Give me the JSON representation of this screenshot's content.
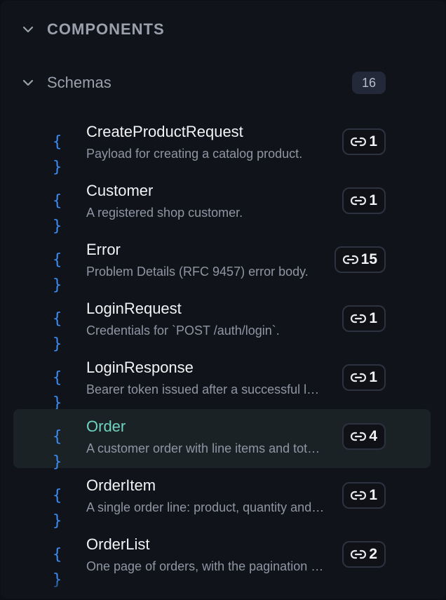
{
  "section": {
    "title": "COMPONENTS",
    "expanded": true,
    "icon": "chevron-down-icon"
  },
  "group": {
    "title": "Schemas",
    "count": "16",
    "expanded": true,
    "icon": "chevron-down-icon"
  },
  "item_icon": "schema-braces-icon",
  "ref_icon": "link-icon",
  "colors": {
    "accent_blue": "#3b8df5",
    "selected_text": "#6fd3c0",
    "selected_bg": "#1a2226"
  },
  "items": [
    {
      "name": "CreateProductRequest",
      "desc": "Payload for creating a catalog product.",
      "refs": "1",
      "selected": false
    },
    {
      "name": "Customer",
      "desc": "A registered shop customer.",
      "refs": "1",
      "selected": false
    },
    {
      "name": "Error",
      "desc": "Problem Details (RFC 9457) error body.",
      "refs": "15",
      "selected": false
    },
    {
      "name": "LoginRequest",
      "desc": "Credentials for `POST /auth/login`.",
      "refs": "1",
      "selected": false
    },
    {
      "name": "LoginResponse",
      "desc": "Bearer token issued after a successful login.",
      "refs": "1",
      "selected": false
    },
    {
      "name": "Order",
      "desc": "A customer order with line items and totals.",
      "refs": "4",
      "selected": true
    },
    {
      "name": "OrderItem",
      "desc": "A single order line: product, quantity and price.",
      "refs": "1",
      "selected": false
    },
    {
      "name": "OrderList",
      "desc": "One page of orders, with the pagination envelope.",
      "refs": "2",
      "selected": false
    }
  ]
}
